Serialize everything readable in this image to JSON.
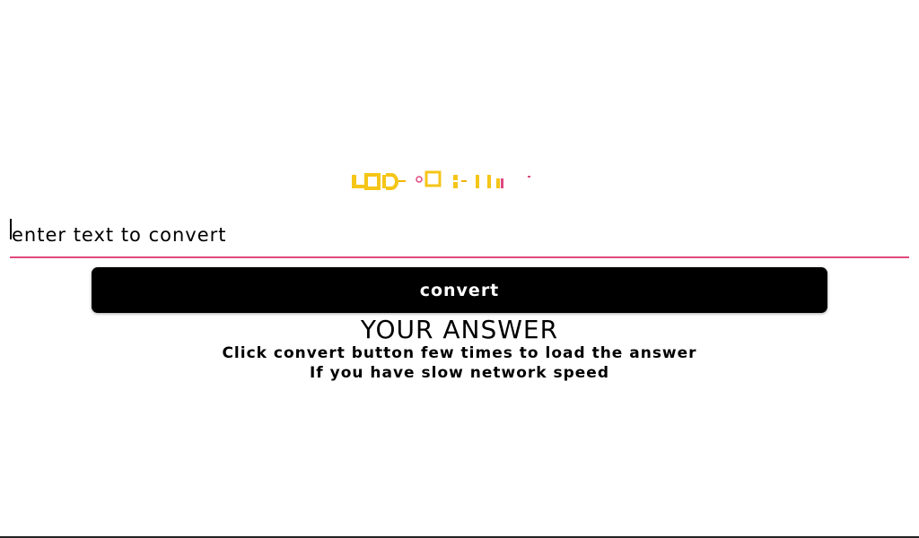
{
  "logo": {
    "text": "LOADING",
    "icon": "logo-loading-glitch",
    "colors": {
      "primary": "#f5c518",
      "accent": "#e0487e"
    }
  },
  "input": {
    "placeholder": "enter text to convert",
    "value": ""
  },
  "button": {
    "label": "convert"
  },
  "answer": {
    "title": "YOUR ANSWER",
    "hint_line1": "Click convert button few times to load the answer",
    "hint_line2": "If you have slow network speed"
  },
  "colors": {
    "underline": "#e0487e",
    "button_bg": "#000000",
    "button_text": "#ffffff"
  }
}
